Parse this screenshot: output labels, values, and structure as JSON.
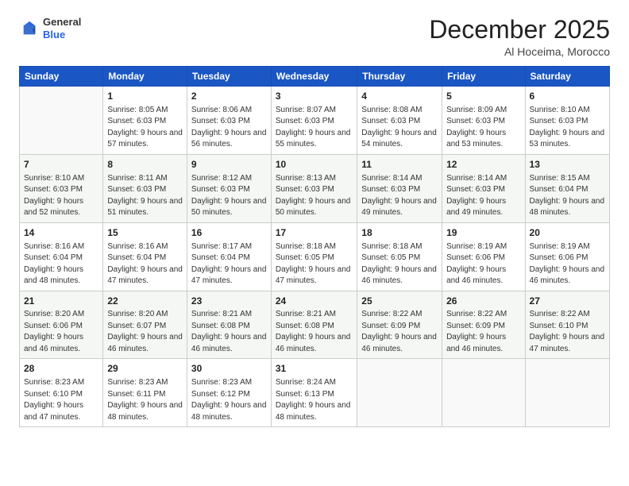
{
  "header": {
    "logo_line1": "General",
    "logo_line2": "Blue",
    "month": "December 2025",
    "location": "Al Hoceima, Morocco"
  },
  "weekdays": [
    "Sunday",
    "Monday",
    "Tuesday",
    "Wednesday",
    "Thursday",
    "Friday",
    "Saturday"
  ],
  "weeks": [
    [
      {
        "day": "",
        "sunrise": "",
        "sunset": "",
        "daylight": ""
      },
      {
        "day": "1",
        "sunrise": "Sunrise: 8:05 AM",
        "sunset": "Sunset: 6:03 PM",
        "daylight": "Daylight: 9 hours and 57 minutes."
      },
      {
        "day": "2",
        "sunrise": "Sunrise: 8:06 AM",
        "sunset": "Sunset: 6:03 PM",
        "daylight": "Daylight: 9 hours and 56 minutes."
      },
      {
        "day": "3",
        "sunrise": "Sunrise: 8:07 AM",
        "sunset": "Sunset: 6:03 PM",
        "daylight": "Daylight: 9 hours and 55 minutes."
      },
      {
        "day": "4",
        "sunrise": "Sunrise: 8:08 AM",
        "sunset": "Sunset: 6:03 PM",
        "daylight": "Daylight: 9 hours and 54 minutes."
      },
      {
        "day": "5",
        "sunrise": "Sunrise: 8:09 AM",
        "sunset": "Sunset: 6:03 PM",
        "daylight": "Daylight: 9 hours and 53 minutes."
      },
      {
        "day": "6",
        "sunrise": "Sunrise: 8:10 AM",
        "sunset": "Sunset: 6:03 PM",
        "daylight": "Daylight: 9 hours and 53 minutes."
      }
    ],
    [
      {
        "day": "7",
        "sunrise": "Sunrise: 8:10 AM",
        "sunset": "Sunset: 6:03 PM",
        "daylight": "Daylight: 9 hours and 52 minutes."
      },
      {
        "day": "8",
        "sunrise": "Sunrise: 8:11 AM",
        "sunset": "Sunset: 6:03 PM",
        "daylight": "Daylight: 9 hours and 51 minutes."
      },
      {
        "day": "9",
        "sunrise": "Sunrise: 8:12 AM",
        "sunset": "Sunset: 6:03 PM",
        "daylight": "Daylight: 9 hours and 50 minutes."
      },
      {
        "day": "10",
        "sunrise": "Sunrise: 8:13 AM",
        "sunset": "Sunset: 6:03 PM",
        "daylight": "Daylight: 9 hours and 50 minutes."
      },
      {
        "day": "11",
        "sunrise": "Sunrise: 8:14 AM",
        "sunset": "Sunset: 6:03 PM",
        "daylight": "Daylight: 9 hours and 49 minutes."
      },
      {
        "day": "12",
        "sunrise": "Sunrise: 8:14 AM",
        "sunset": "Sunset: 6:03 PM",
        "daylight": "Daylight: 9 hours and 49 minutes."
      },
      {
        "day": "13",
        "sunrise": "Sunrise: 8:15 AM",
        "sunset": "Sunset: 6:04 PM",
        "daylight": "Daylight: 9 hours and 48 minutes."
      }
    ],
    [
      {
        "day": "14",
        "sunrise": "Sunrise: 8:16 AM",
        "sunset": "Sunset: 6:04 PM",
        "daylight": "Daylight: 9 hours and 48 minutes."
      },
      {
        "day": "15",
        "sunrise": "Sunrise: 8:16 AM",
        "sunset": "Sunset: 6:04 PM",
        "daylight": "Daylight: 9 hours and 47 minutes."
      },
      {
        "day": "16",
        "sunrise": "Sunrise: 8:17 AM",
        "sunset": "Sunset: 6:04 PM",
        "daylight": "Daylight: 9 hours and 47 minutes."
      },
      {
        "day": "17",
        "sunrise": "Sunrise: 8:18 AM",
        "sunset": "Sunset: 6:05 PM",
        "daylight": "Daylight: 9 hours and 47 minutes."
      },
      {
        "day": "18",
        "sunrise": "Sunrise: 8:18 AM",
        "sunset": "Sunset: 6:05 PM",
        "daylight": "Daylight: 9 hours and 46 minutes."
      },
      {
        "day": "19",
        "sunrise": "Sunrise: 8:19 AM",
        "sunset": "Sunset: 6:06 PM",
        "daylight": "Daylight: 9 hours and 46 minutes."
      },
      {
        "day": "20",
        "sunrise": "Sunrise: 8:19 AM",
        "sunset": "Sunset: 6:06 PM",
        "daylight": "Daylight: 9 hours and 46 minutes."
      }
    ],
    [
      {
        "day": "21",
        "sunrise": "Sunrise: 8:20 AM",
        "sunset": "Sunset: 6:06 PM",
        "daylight": "Daylight: 9 hours and 46 minutes."
      },
      {
        "day": "22",
        "sunrise": "Sunrise: 8:20 AM",
        "sunset": "Sunset: 6:07 PM",
        "daylight": "Daylight: 9 hours and 46 minutes."
      },
      {
        "day": "23",
        "sunrise": "Sunrise: 8:21 AM",
        "sunset": "Sunset: 6:08 PM",
        "daylight": "Daylight: 9 hours and 46 minutes."
      },
      {
        "day": "24",
        "sunrise": "Sunrise: 8:21 AM",
        "sunset": "Sunset: 6:08 PM",
        "daylight": "Daylight: 9 hours and 46 minutes."
      },
      {
        "day": "25",
        "sunrise": "Sunrise: 8:22 AM",
        "sunset": "Sunset: 6:09 PM",
        "daylight": "Daylight: 9 hours and 46 minutes."
      },
      {
        "day": "26",
        "sunrise": "Sunrise: 8:22 AM",
        "sunset": "Sunset: 6:09 PM",
        "daylight": "Daylight: 9 hours and 46 minutes."
      },
      {
        "day": "27",
        "sunrise": "Sunrise: 8:22 AM",
        "sunset": "Sunset: 6:10 PM",
        "daylight": "Daylight: 9 hours and 47 minutes."
      }
    ],
    [
      {
        "day": "28",
        "sunrise": "Sunrise: 8:23 AM",
        "sunset": "Sunset: 6:10 PM",
        "daylight": "Daylight: 9 hours and 47 minutes."
      },
      {
        "day": "29",
        "sunrise": "Sunrise: 8:23 AM",
        "sunset": "Sunset: 6:11 PM",
        "daylight": "Daylight: 9 hours and 48 minutes."
      },
      {
        "day": "30",
        "sunrise": "Sunrise: 8:23 AM",
        "sunset": "Sunset: 6:12 PM",
        "daylight": "Daylight: 9 hours and 48 minutes."
      },
      {
        "day": "31",
        "sunrise": "Sunrise: 8:24 AM",
        "sunset": "Sunset: 6:13 PM",
        "daylight": "Daylight: 9 hours and 48 minutes."
      },
      {
        "day": "",
        "sunrise": "",
        "sunset": "",
        "daylight": ""
      },
      {
        "day": "",
        "sunrise": "",
        "sunset": "",
        "daylight": ""
      },
      {
        "day": "",
        "sunrise": "",
        "sunset": "",
        "daylight": ""
      }
    ]
  ]
}
